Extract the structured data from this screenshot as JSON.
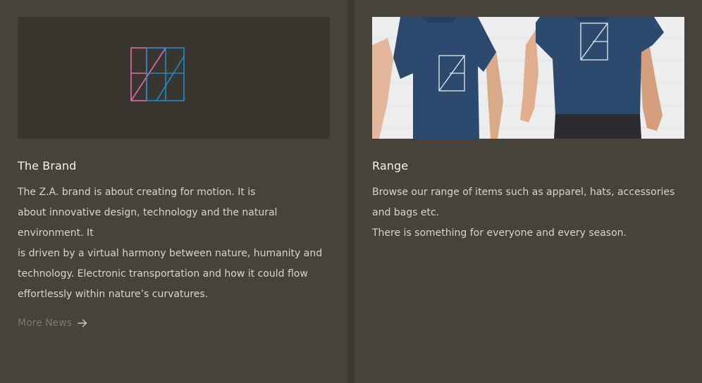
{
  "cards": [
    {
      "title": "The Brand",
      "body": [
        "The Z.A. brand is about creating for motion. It is",
        "about innovative design, technology and the natural",
        "environment. It",
        "is driven by a virtual harmony between nature, humanity and",
        "technology. Electronic transportation and how it could flow",
        "effortlessly within nature’s curvatures."
      ],
      "link_label": "More News",
      "link_icon": "arrow-right-icon",
      "media_icon": "brand-logo-icon"
    },
    {
      "title": "Range",
      "body": [
        "Browse our range of items such as apparel, hats, accessories",
        "and bags etc.",
        "There is something for everyone and every season."
      ],
      "media_icon": "tshirt-models-image"
    }
  ],
  "colors": {
    "page_bg": "#3e3a32",
    "card_bg": "#48433a",
    "logo_pink": "#e06ab0",
    "logo_blue": "#1e8ac8",
    "shirt_navy": "#2c4a6e"
  }
}
